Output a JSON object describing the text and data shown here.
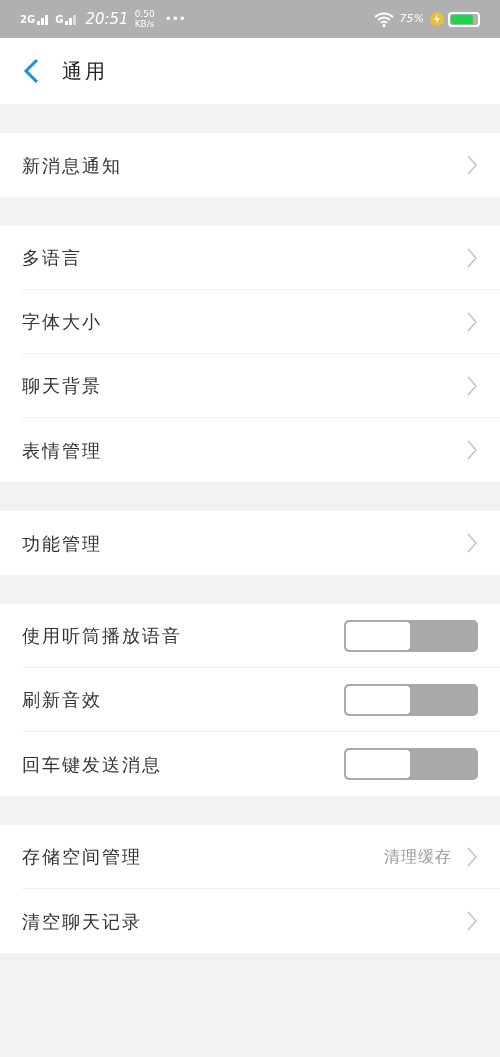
{
  "status_bar": {
    "network_1": "2G",
    "network_2": "G",
    "time": "20:51",
    "speed": "0.50",
    "speed_unit": "KB/s",
    "more": "•••",
    "battery_percent": "75%",
    "charging": true
  },
  "header": {
    "title": "通用"
  },
  "sections": [
    [
      {
        "kind": "link",
        "label": "新消息通知"
      }
    ],
    [
      {
        "kind": "link",
        "label": "多语言"
      },
      {
        "kind": "link",
        "label": "字体大小"
      },
      {
        "kind": "link",
        "label": "聊天背景"
      },
      {
        "kind": "link",
        "label": "表情管理"
      }
    ],
    [
      {
        "kind": "link",
        "label": "功能管理"
      }
    ],
    [
      {
        "kind": "toggle",
        "label": "使用听筒播放语音",
        "on": false
      },
      {
        "kind": "toggle",
        "label": "刷新音效",
        "on": false
      },
      {
        "kind": "toggle",
        "label": "回车键发送消息",
        "on": false
      }
    ],
    [
      {
        "kind": "link",
        "label": "存储空间管理",
        "value": "清理缓存"
      },
      {
        "kind": "link",
        "label": "清空聊天记录"
      }
    ]
  ]
}
